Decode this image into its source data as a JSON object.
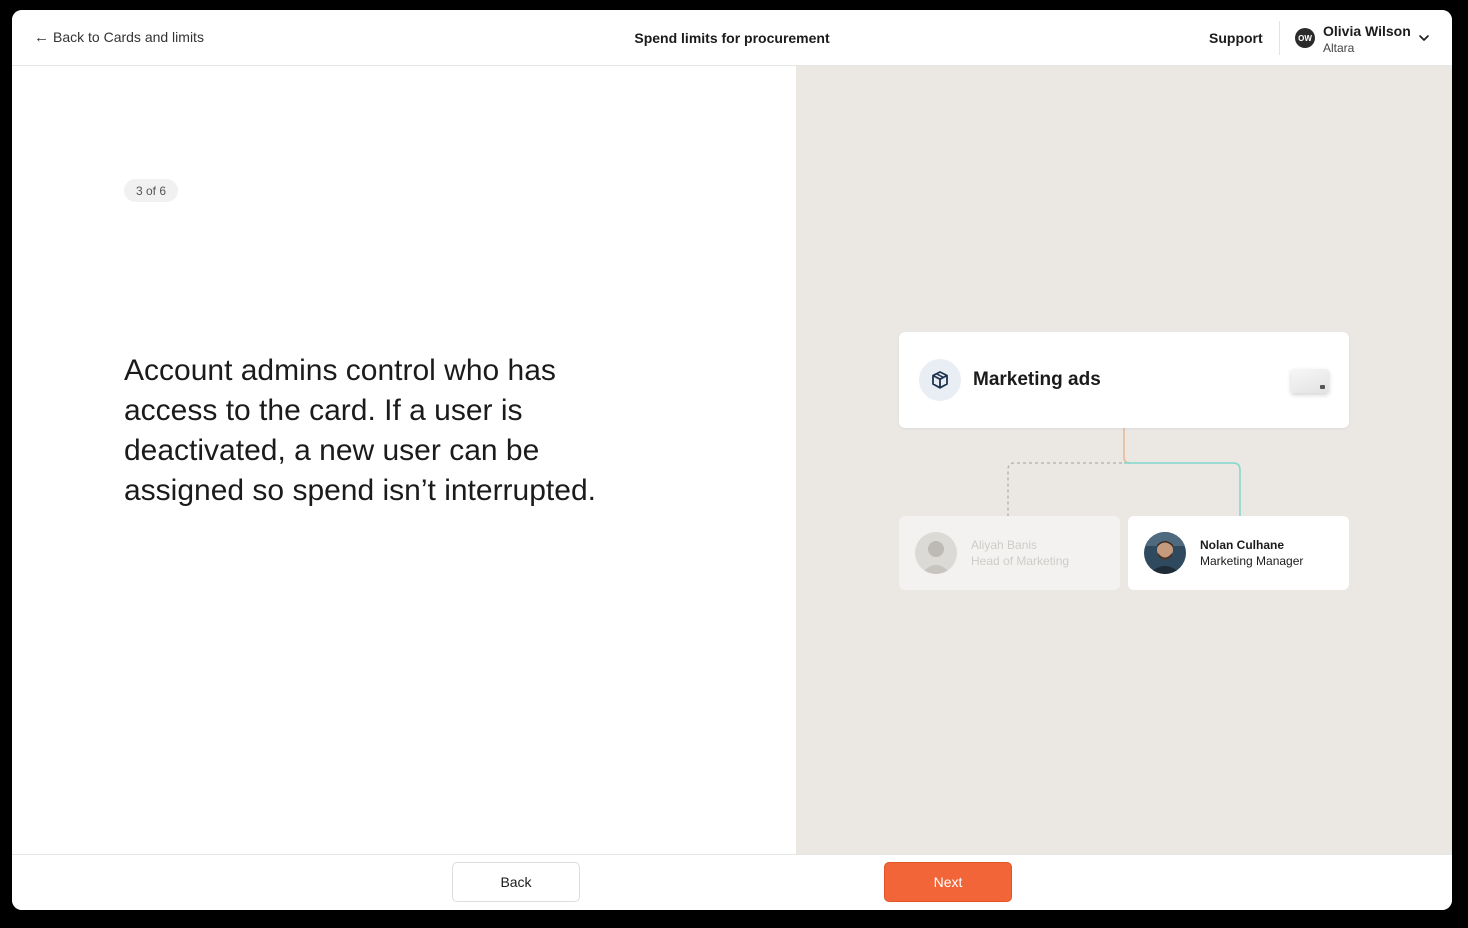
{
  "header": {
    "back_label": "Back to Cards and limits",
    "title": "Spend limits for procurement",
    "support_label": "Support",
    "user": {
      "initials": "OW",
      "name": "Olivia Wilson",
      "org": "Altara"
    }
  },
  "content": {
    "step": "3 of 6",
    "body": "Account admins control who has access to the card. If a user is deactivated, a new user can be assigned so spend isn’t interrupted."
  },
  "illustration": {
    "card_name": "Marketing ads",
    "previous_user": {
      "name": "Aliyah Banis",
      "role": "Head of Marketing"
    },
    "current_user": {
      "name": "Nolan Culhane",
      "role": "Marketing Manager"
    },
    "colors": {
      "connector_main": "#e5b896",
      "connector_active": "#7fd8cf",
      "connector_inactive": "#b9b6b2"
    }
  },
  "footer": {
    "back_label": "Back",
    "next_label": "Next",
    "next_color": "#f26538"
  }
}
